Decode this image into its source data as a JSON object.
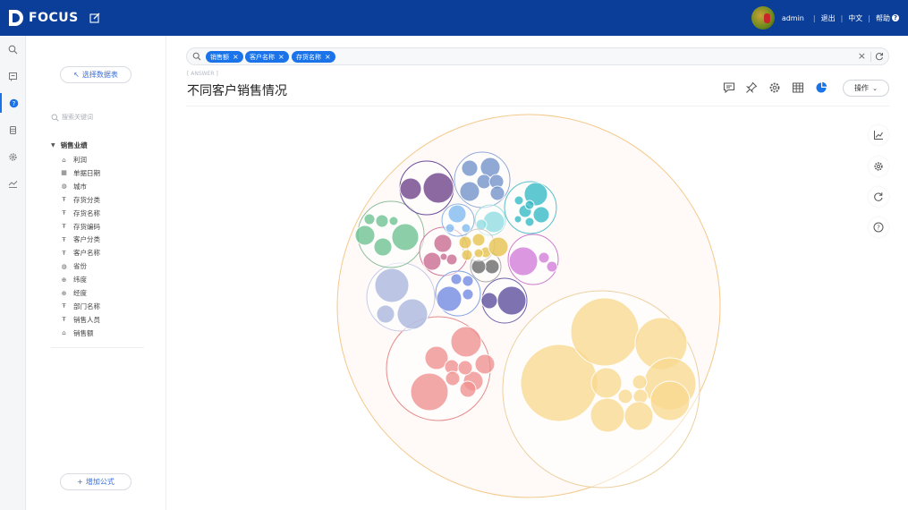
{
  "topbar": {
    "brand": "FOCUS",
    "user": "admin",
    "logout": "退出",
    "language": "中文",
    "help": "帮助"
  },
  "side": {
    "select_table": "选择数据表",
    "search_placeholder": "搜索关键词",
    "group": "销售业绩",
    "fields": [
      {
        "label": "利润",
        "icon": "measure-icon"
      },
      {
        "label": "单据日期",
        "icon": "calendar-icon"
      },
      {
        "label": "城市",
        "icon": "globe-icon"
      },
      {
        "label": "存货分类",
        "icon": "text-attr-icon"
      },
      {
        "label": "存货名称",
        "icon": "text-attr-icon"
      },
      {
        "label": "存货编码",
        "icon": "text-attr-icon"
      },
      {
        "label": "客户分类",
        "icon": "text-attr-icon"
      },
      {
        "label": "客户名称",
        "icon": "text-attr-icon"
      },
      {
        "label": "省份",
        "icon": "globe-icon"
      },
      {
        "label": "纬度",
        "icon": "geo-icon"
      },
      {
        "label": "经度",
        "icon": "geo-icon"
      },
      {
        "label": "部门名称",
        "icon": "text-attr-icon"
      },
      {
        "label": "销售人员",
        "icon": "text-attr-icon"
      },
      {
        "label": "销售额",
        "icon": "measure-icon"
      }
    ],
    "add_formula": "增加公式"
  },
  "search": {
    "chips": [
      "销售额",
      "客户名称",
      "存货名称"
    ]
  },
  "answer_tag": "[ ANSWER ]",
  "title": "不同客户销售情况",
  "operate_label": "操作",
  "colors": {
    "topbar": "#0a3e98",
    "accent": "#1a73e8"
  },
  "chart_data": {
    "type": "circle-packing",
    "root_stroke": "#f3c98a",
    "groups": [
      {
        "color": "#ecd1a1",
        "fill": "#f8d88f",
        "leaf_values": [
          100,
          75,
          42,
          16,
          16,
          24,
          10,
          10,
          13,
          18,
          20
        ]
      },
      {
        "color": "#e58a8a",
        "fill": "#ef8f8f",
        "leaf_values": [
          28,
          17,
          11,
          10,
          10,
          7,
          6,
          6,
          8
        ]
      },
      {
        "color": "#c2c9e8",
        "fill": "#a9b6dd",
        "leaf_values": [
          20,
          14,
          10
        ]
      },
      {
        "color": "#8fbf9d",
        "fill": "#6cc08f",
        "leaf_values": [
          14,
          7,
          6,
          5,
          3,
          3
        ]
      },
      {
        "color": "#6b4b9b",
        "fill": "#6b3f86",
        "leaf_values": [
          16,
          8
        ]
      },
      {
        "color": "#8fa8d8",
        "fill": "#6f90c8",
        "leaf_values": [
          7,
          7,
          6,
          4,
          3,
          3
        ]
      },
      {
        "color": "#58bfc9",
        "fill": "#33b8c4",
        "leaf_values": [
          9,
          7,
          4,
          2,
          2,
          2,
          3
        ]
      },
      {
        "color": "#cc79cc",
        "fill": "#d17bd8",
        "leaf_values": [
          14,
          3,
          3
        ]
      },
      {
        "color": "#d07a9c",
        "fill": "#c8688e",
        "leaf_values": [
          6,
          6,
          3,
          2
        ]
      },
      {
        "color": "#8ab4e6",
        "fill": "#7fb8ee",
        "leaf_values": [
          6,
          2,
          2
        ]
      },
      {
        "color": "#7ea0e3",
        "fill": "#6f86e0",
        "leaf_values": [
          8,
          2,
          2,
          2
        ]
      },
      {
        "color": "#6c5fa8",
        "fill": "#5a4a9b",
        "leaf_values": [
          12,
          3
        ]
      },
      {
        "color": "#9fe0e0",
        "fill": "#8fdde0",
        "leaf_values": [
          4,
          2
        ]
      },
      {
        "color": "#aaaaaa",
        "fill": "#666666",
        "leaf_values": [
          3,
          3
        ]
      },
      {
        "color": "#cccccc",
        "fill": "#e5c24a",
        "leaf_values": [
          2,
          2,
          2,
          3,
          2,
          2
        ]
      }
    ]
  }
}
